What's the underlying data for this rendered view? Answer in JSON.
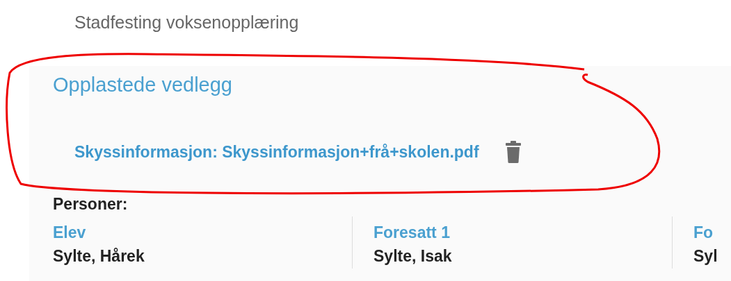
{
  "heading": "Stadfesting voksenopplæring",
  "attachments": {
    "title": "Opplastede vedlegg",
    "files": [
      {
        "label": "Skyssinformasjon: Skyssinformasjon+frå+skolen.pdf"
      }
    ]
  },
  "persons": {
    "title": "Personer:",
    "columns": [
      {
        "role": "Elev",
        "name": "Sylte, Hårek"
      },
      {
        "role": "Foresatt 1",
        "name": "Sylte, Isak"
      },
      {
        "role": "Fo",
        "name": "Syl"
      }
    ]
  }
}
